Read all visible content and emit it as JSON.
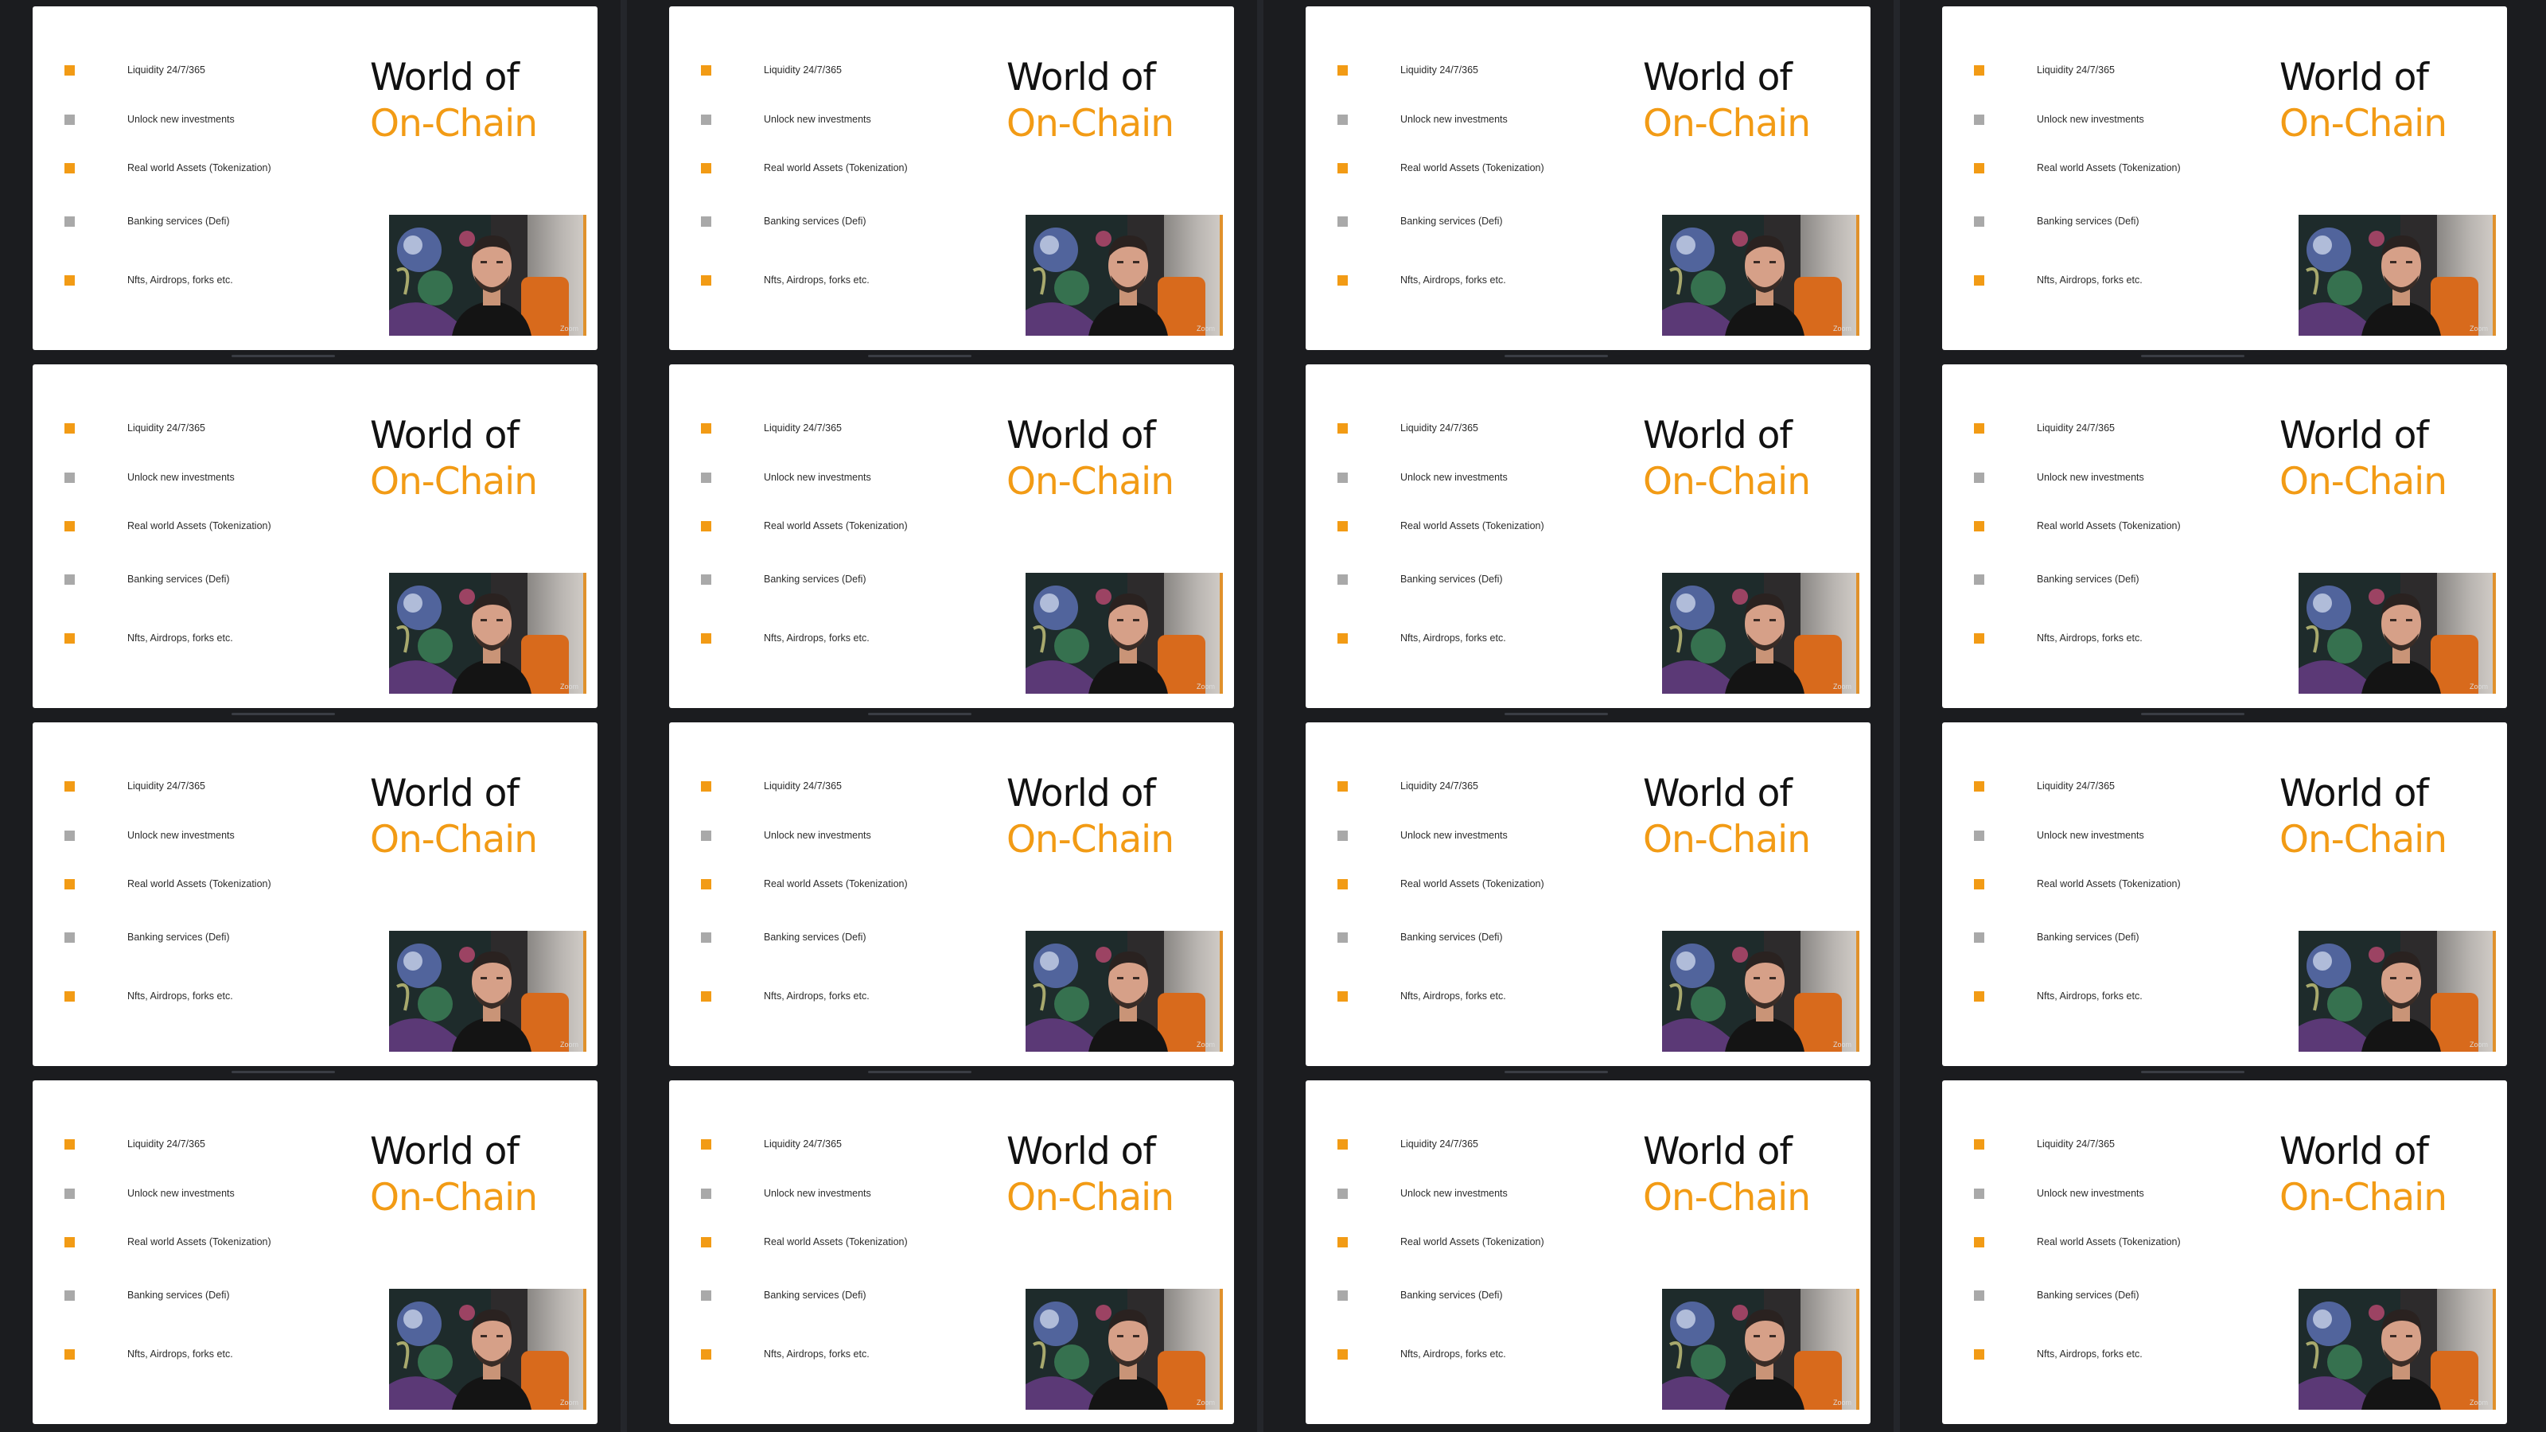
{
  "slide": {
    "title_line1": "World of",
    "title_line2": "On-Chain",
    "bullets": [
      {
        "label": "Liquidity 24/7/365",
        "color": "#f29b15"
      },
      {
        "label": "Unlock new investments",
        "color": "#a9a9a9"
      },
      {
        "label": "Real world Assets (Tokenization)",
        "color": "#f29b15"
      },
      {
        "label": "Banking services (Defi)",
        "color": "#a9a9a9"
      },
      {
        "label": "Nfts, Airdrops, forks etc.",
        "color": "#f29b15"
      }
    ],
    "video_label": "Zoom"
  },
  "thumbnails": [
    {
      "row": 1,
      "col": 1
    },
    {
      "row": 1,
      "col": 2
    },
    {
      "row": 1,
      "col": 3
    },
    {
      "row": 1,
      "col": 4
    },
    {
      "row": 2,
      "col": 1
    },
    {
      "row": 2,
      "col": 2
    },
    {
      "row": 2,
      "col": 3
    },
    {
      "row": 2,
      "col": 4
    },
    {
      "row": 3,
      "col": 1
    },
    {
      "row": 3,
      "col": 2
    },
    {
      "row": 3,
      "col": 3
    },
    {
      "row": 3,
      "col": 4
    },
    {
      "row": 4,
      "col": 1
    },
    {
      "row": 4,
      "col": 2
    },
    {
      "row": 4,
      "col": 3
    },
    {
      "row": 4,
      "col": 4
    }
  ],
  "colors": {
    "background": "#1b1c1f",
    "accent": "#f29b15",
    "neutral_bullet": "#a9a9a9",
    "slide_bg": "#ffffff"
  },
  "icons": {
    "video": "webcam-feed-icon"
  }
}
